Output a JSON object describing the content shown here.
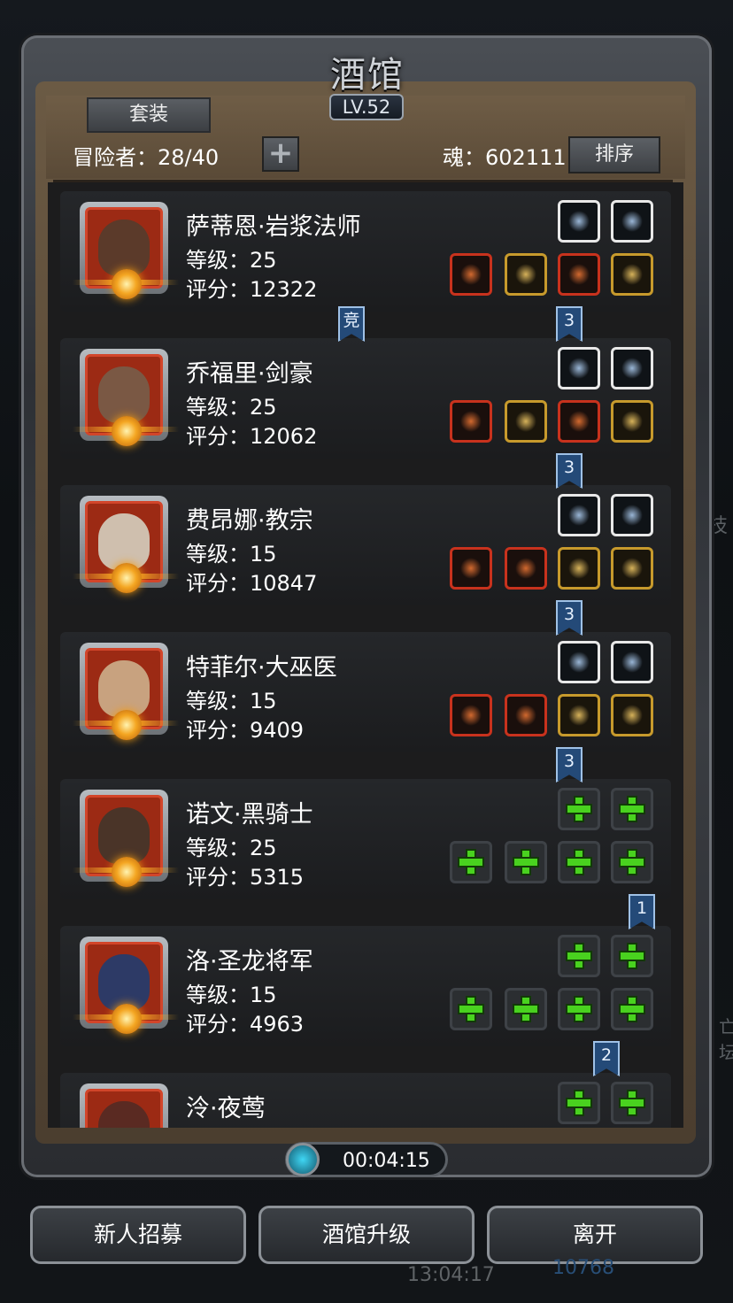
{
  "header": {
    "title": "酒馆",
    "level": "LV.52",
    "set_button": "套装",
    "adventurers_label": "冒险者：28/40",
    "add_button": "+",
    "soul_label": "魂：602111",
    "sort_button": "排序"
  },
  "heroes": [
    {
      "name": "萨蒂恩·岩浆法师",
      "level": "等级：25",
      "score": "评分：12322",
      "top_slots": [
        "white",
        "white"
      ],
      "bottom_slots": [
        "red",
        "gold",
        "red",
        "gold"
      ],
      "top_icons": [
        "crystal-icon",
        "bow-icon"
      ],
      "bottom_icons": [
        "staff-icon",
        "armor-icon",
        "book-icon",
        "ring-icon"
      ]
    },
    {
      "name": "乔福里·剑豪",
      "level": "等级：25",
      "score": "评分：12062",
      "top_slots": [
        "white",
        "white"
      ],
      "bottom_slots": [
        "red",
        "gold",
        "red",
        "gold"
      ],
      "top_icons": [
        "crossbow-icon",
        "dagger-icon"
      ],
      "bottom_icons": [
        "sword-icon",
        "armor-icon",
        "amulet-icon",
        "bracer-icon"
      ]
    },
    {
      "name": "费昂娜·教宗",
      "level": "等级：15",
      "score": "评分：10847",
      "top_slots": [
        "white",
        "white"
      ],
      "bottom_slots": [
        "red",
        "red",
        "gold",
        "gold"
      ],
      "top_icons": [
        "wing-icon",
        "dagger-icon"
      ],
      "bottom_icons": [
        "hammer-icon",
        "robe-icon",
        "cross-icon",
        "ring-icon"
      ]
    },
    {
      "name": "特菲尔·大巫医",
      "level": "等级：15",
      "score": "评分：9409",
      "top_slots": [
        "white",
        "white"
      ],
      "bottom_slots": [
        "red",
        "red",
        "gold",
        "gold"
      ],
      "top_icons": [
        "emblem-icon",
        "tome-icon"
      ],
      "bottom_icons": [
        "wand-icon",
        "armor-icon",
        "necklace-icon",
        "boots-icon"
      ]
    },
    {
      "name": "诺文·黑骑士",
      "level": "等级：25",
      "score": "评分：5315",
      "top_slots": [
        "empty",
        "empty"
      ],
      "bottom_slots": [
        "empty",
        "empty",
        "empty",
        "empty"
      ],
      "top_icons": [
        "plus-icon",
        "plus-icon"
      ],
      "bottom_icons": [
        "plus-icon",
        "plus-icon",
        "plus-icon",
        "plus-icon"
      ]
    },
    {
      "name": "洛·圣龙将军",
      "level": "等级：15",
      "score": "评分：4963",
      "top_slots": [
        "empty",
        "empty"
      ],
      "bottom_slots": [
        "empty",
        "empty",
        "empty",
        "empty"
      ],
      "top_icons": [
        "plus-icon",
        "plus-icon"
      ],
      "bottom_icons": [
        "plus-icon",
        "plus-icon",
        "plus-icon",
        "plus-icon"
      ]
    },
    {
      "name": "泠·夜莺",
      "level": "",
      "score": "",
      "top_slots": [
        "empty",
        "empty"
      ],
      "bottom_slots": [],
      "top_icons": [
        "plus-icon",
        "plus-icon"
      ],
      "bottom_icons": []
    }
  ],
  "tags": [
    "竞",
    "3",
    "3",
    "3",
    "3",
    "1",
    "2"
  ],
  "timer": "00:04:15",
  "buttons": {
    "recruit": "新人招募",
    "upgrade": "酒馆升级",
    "leave": "离开"
  },
  "background": {
    "clock": "13:04:17",
    "gems": "10768",
    "side_1": "技",
    "side_2": "亡坛"
  },
  "colors": {
    "slot_red": "#c8321d",
    "slot_gold": "#c79a2c",
    "plus_green": "#49d21f",
    "tag_blue": "#244a78"
  }
}
